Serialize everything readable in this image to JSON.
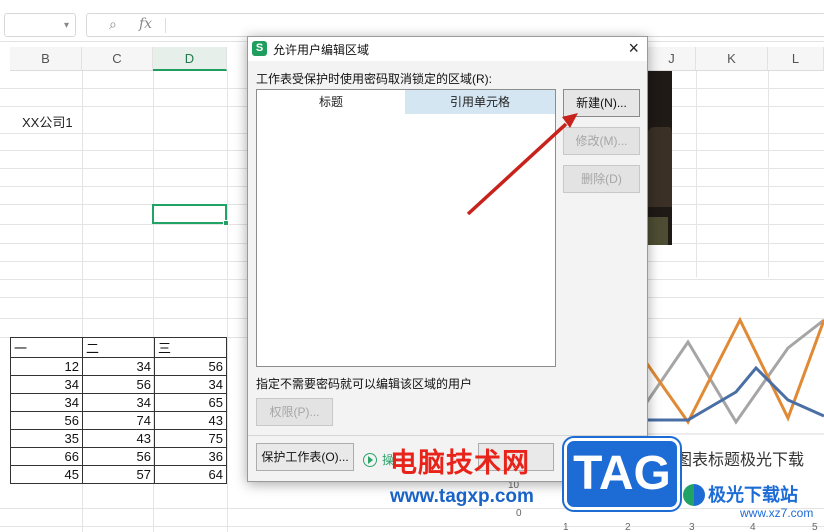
{
  "formula_bar": {
    "fx_label": "fx",
    "zoom_icon": "magnifier-icon"
  },
  "columns": [
    "B",
    "C",
    "D",
    "J",
    "K",
    "L"
  ],
  "active_column": "D",
  "cells": {
    "b_label": "XX公司1"
  },
  "table": {
    "header": [
      "一",
      "二",
      "三"
    ],
    "rows": [
      [
        "12",
        "34",
        "56"
      ],
      [
        "34",
        "56",
        "34"
      ],
      [
        "34",
        "34",
        "65"
      ],
      [
        "56",
        "74",
        "43"
      ],
      [
        "35",
        "43",
        "75"
      ],
      [
        "66",
        "56",
        "36"
      ],
      [
        "45",
        "57",
        "64"
      ]
    ]
  },
  "chart": {
    "title": "图表标题极光下载",
    "y_tick": "10",
    "y_zero": "0",
    "x_ticks": [
      "1",
      "2",
      "3",
      "4",
      "5"
    ],
    "colors": {
      "orange": "#e08a36",
      "gray": "#a5a5a5",
      "blue": "#4a6fa5"
    }
  },
  "dialog": {
    "title": "允许用户编辑区域",
    "app_logo": "S",
    "close_glyph": "×",
    "list_caption": "工作表受保护时使用密码取消锁定的区域(R):",
    "col_title": "标题",
    "col_ref": "引用单元格",
    "btn_new": "新建(N)...",
    "btn_modify": "修改(M)...",
    "btn_delete": "删除(D)",
    "users_caption": "指定不需要密码就可以编辑该区域的用户",
    "btn_permission": "权限(P)...",
    "btn_protect": "保护工作表(O)...",
    "help_partial": "操"
  },
  "watermark": {
    "site_name": "电脑技术网",
    "site_url": "www.tagxp.com",
    "tag_logo": "TAG",
    "jg_name": "极光下载站",
    "jg_url": "www.xz7.com"
  }
}
